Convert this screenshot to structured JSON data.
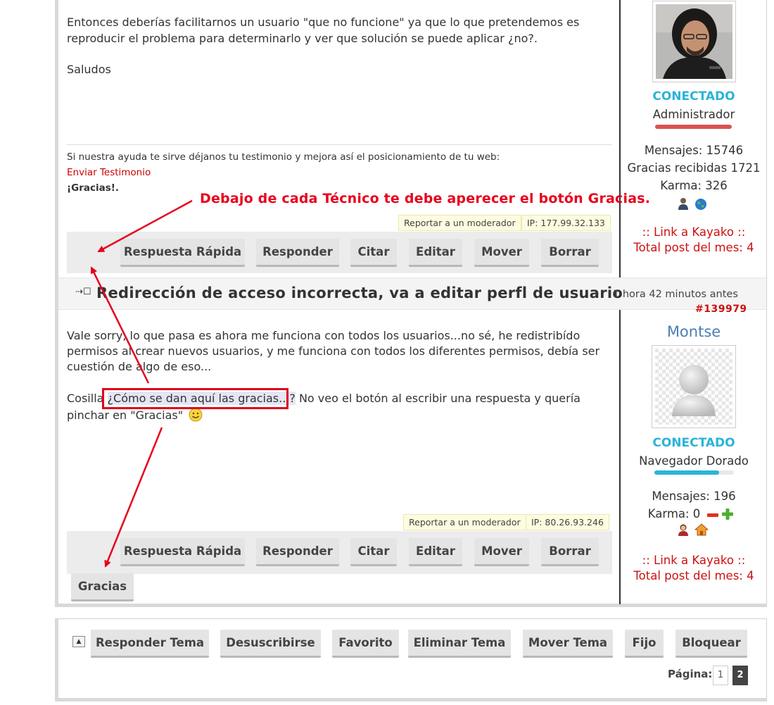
{
  "post1": {
    "message": [
      "Entonces deberías facilitarnos un usuario \"que no funcione\" ya que lo que pretendemos es",
      "reproducir el problema para determinarlo y ver que solución se puede aplicar ¿no?.",
      "Saludos"
    ],
    "signature": {
      "line1": "Si nuestra ayuda te sirve déjanos tu testimonio y mejora así el posicionamiento de tu web:",
      "link": "Enviar Testimonio",
      "thanks": "¡Gracias!."
    },
    "report": "Reportar a un moderador",
    "ip": "IP: 177.99.32.133",
    "buttons": [
      "Respuesta Rápida",
      "Responder",
      "Citar",
      "Editar",
      "Mover",
      "Borrar"
    ],
    "author": {
      "status": "CONECTADO",
      "rank": "Administrador",
      "rank_color": "#d9534f",
      "messages": "Mensajes: 15746",
      "thanks": "Gracias recibidas 1721",
      "karma": "Karma: 326",
      "kayako": ":: Link a Kayako ::",
      "monthly": "Total post del mes: 4"
    }
  },
  "post2": {
    "subject": "Redirección de acceso incorrecta, va a editar perfl de usuario",
    "time": "1 hora 42 minutos antes",
    "number": "#139979",
    "message": {
      "line1": "Vale sorry, lo que pasa es ahora me funciona con todos los usuarios...no sé, he redistribído",
      "line2": "permisos al crear nuevos usuarios, y me funciona con todos los diferentes permisos, debía ser",
      "line3": "cuestión de algo de eso...",
      "line4_pre": "Cosilla ",
      "line4_highlight": "¿Cómo se dan aquí las gracias...?",
      "line4_post": " No veo el botón al escribir una respuesta y quería",
      "line5": "pinchar en \"Gracias\""
    },
    "report": "Reportar a un moderador",
    "ip": "IP: 80.26.93.246",
    "buttons": [
      "Respuesta Rápida",
      "Responder",
      "Citar",
      "Editar",
      "Mover",
      "Borrar"
    ],
    "gracias_button": "Gracias",
    "author": {
      "name": "Montse",
      "status": "CONECTADO",
      "rank": "Navegador Dorado",
      "rank_color": "#2ab4d8",
      "messages": "Mensajes: 196",
      "karma": "Karma: 0",
      "kayako": ":: Link a Kayako ::",
      "monthly": "Total post del mes: 4"
    }
  },
  "annotation": "Debajo de cada Técnico te debe aperecer el botón Gracias.",
  "thread_tools": {
    "buttons": [
      "Responder Tema",
      "Desuscribirse",
      "Favorito",
      "Eliminar Tema",
      "Mover Tema",
      "Fijo",
      "Bloquear"
    ],
    "pager_label": "Página:",
    "pages": [
      "1",
      "2"
    ],
    "current_page": "2"
  },
  "colors": {
    "annotation_red": "#e8001c",
    "online": "#2ab4d8",
    "link_red": "#cc0000"
  }
}
